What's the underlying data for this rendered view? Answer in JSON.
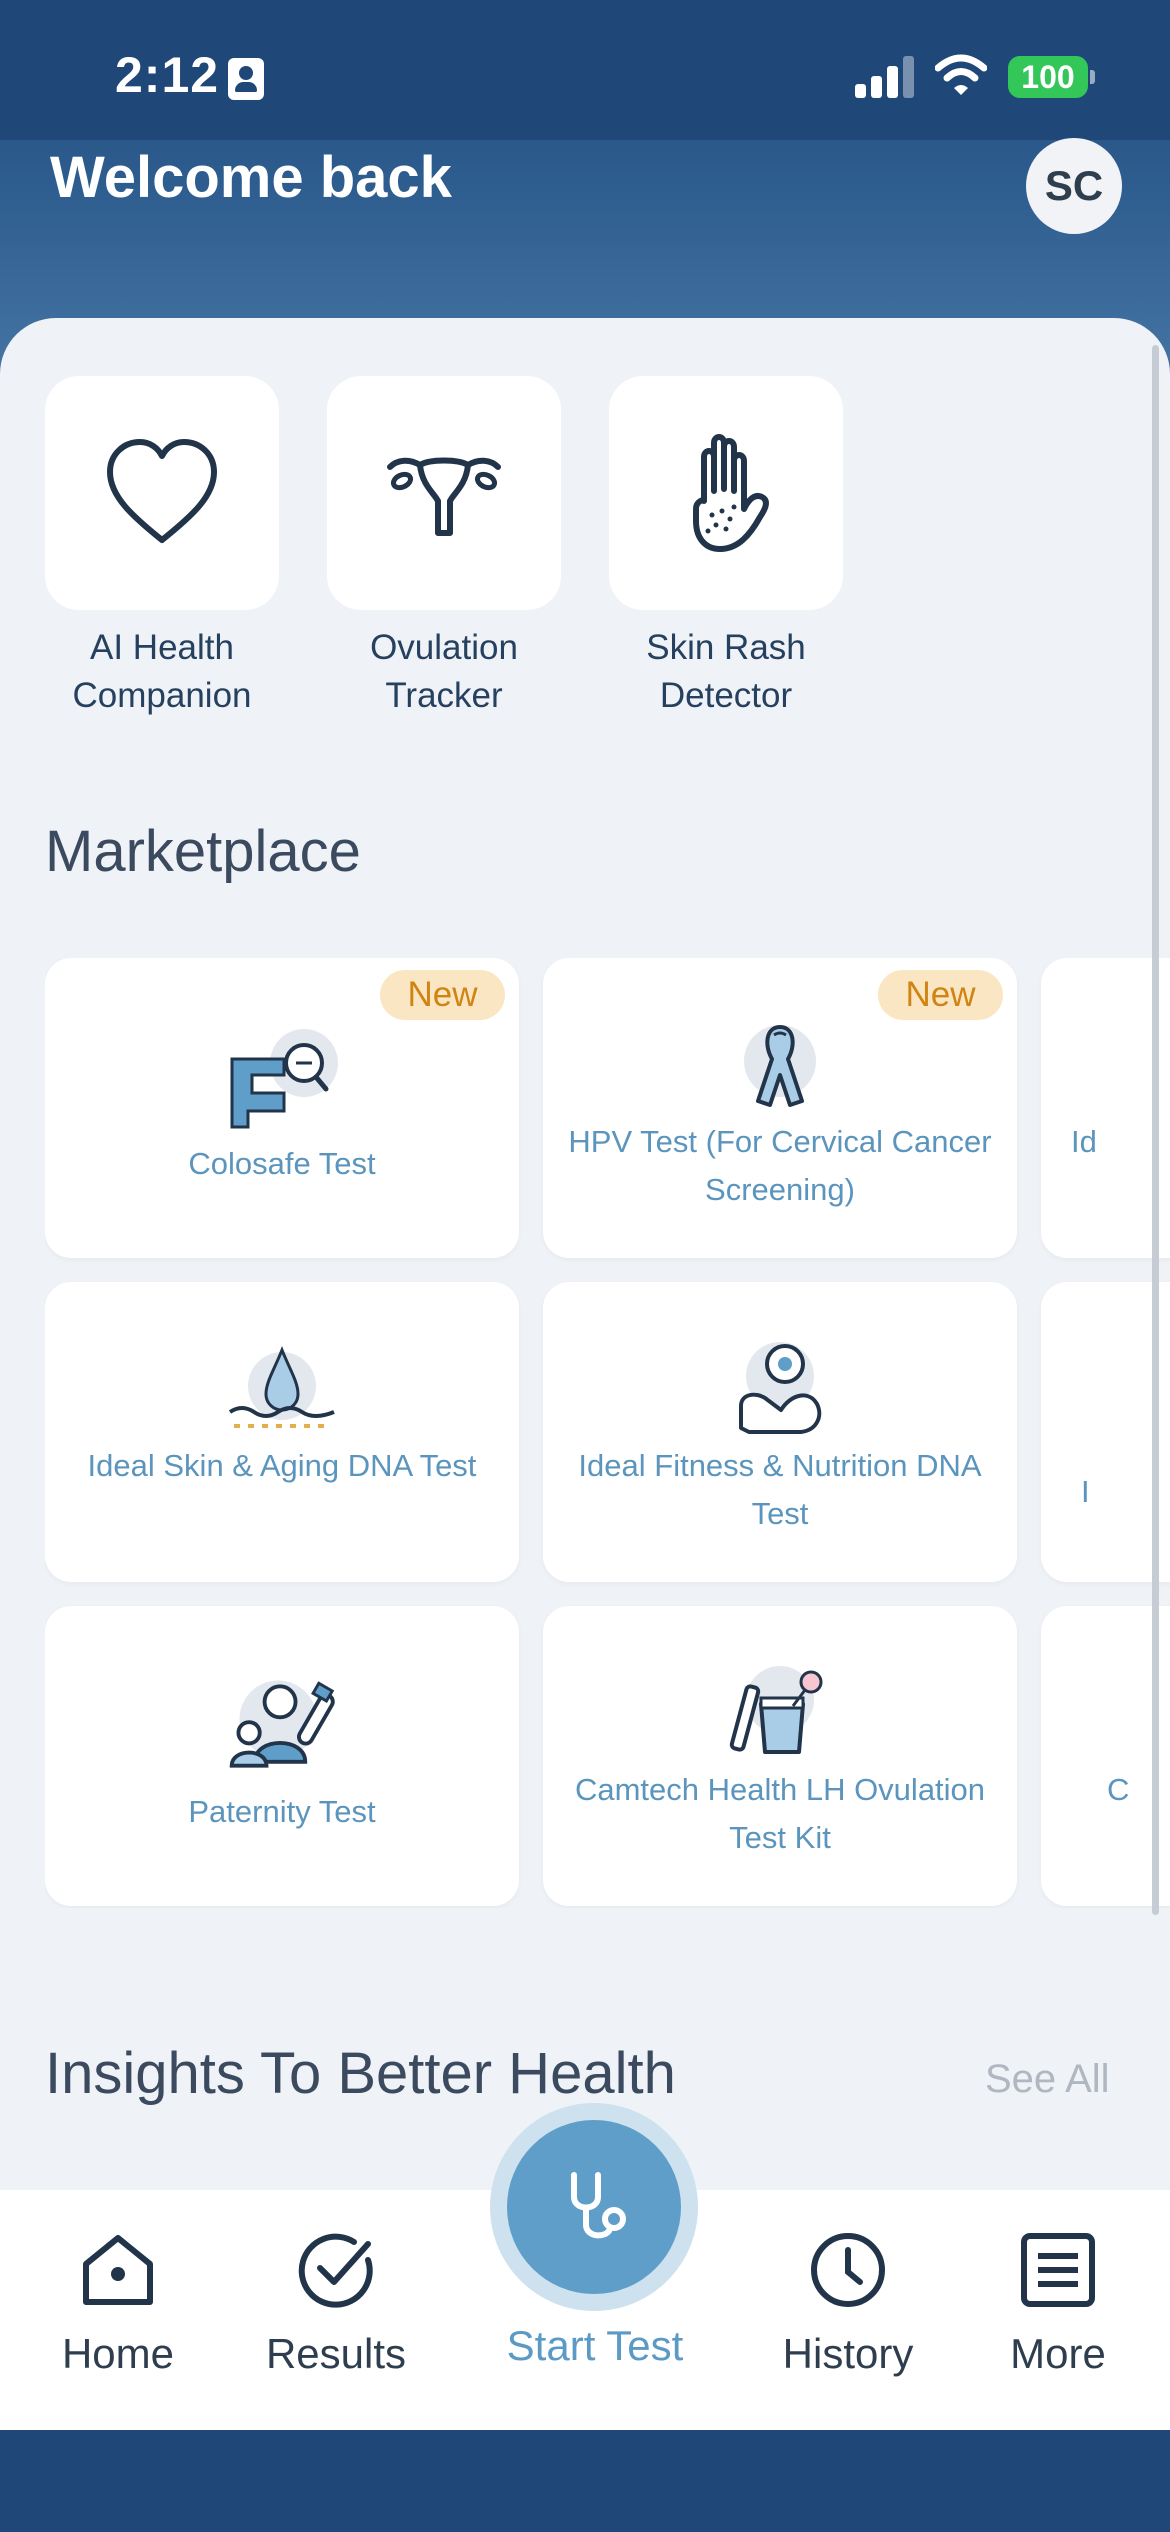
{
  "status_bar": {
    "time": "2:12",
    "battery": "100"
  },
  "header": {
    "welcome": "Welcome back",
    "avatar_initials": "SC"
  },
  "quick_actions": [
    {
      "label": "AI Health Companion",
      "icon": "heart-icon"
    },
    {
      "label": "Ovulation Tracker",
      "icon": "uterus-icon"
    },
    {
      "label": "Skin Rash Detector",
      "icon": "hand-rash-icon"
    }
  ],
  "marketplace": {
    "title": "Marketplace",
    "badge": "New",
    "cards": [
      {
        "label": "Colosafe Test",
        "badge": "New",
        "icon": "colon-test-icon"
      },
      {
        "label": "HPV Test (For Cervical Cancer Screening)",
        "badge": "New",
        "icon": "awareness-ribbon-icon"
      },
      {
        "label": "Id",
        "icon": "partial-icon"
      },
      {
        "label": "Ideal Skin & Aging DNA Test",
        "icon": "skin-drop-icon"
      },
      {
        "label": "Ideal Fitness & Nutrition DNA Test",
        "icon": "fitness-arm-icon"
      },
      {
        "label": "I",
        "icon": "partial-icon"
      },
      {
        "label": "Paternity Test",
        "icon": "paternity-icon"
      },
      {
        "label": "Camtech Health LH Ovulation Test Kit",
        "icon": "ovulation-kit-icon"
      },
      {
        "label": "C",
        "icon": "partial-icon"
      }
    ]
  },
  "insights": {
    "title": "Insights To Better Health",
    "see_all": "See All"
  },
  "nav": {
    "home": "Home",
    "results": "Results",
    "start_test": "Start Test",
    "history": "History",
    "more": "More"
  },
  "colors": {
    "header": "#1f4a7a",
    "accent": "#5e9ec8",
    "card_text": "#5b95bd",
    "badge_bg": "#fbe6c4",
    "badge_text": "#d08412",
    "battery": "#33c759"
  }
}
